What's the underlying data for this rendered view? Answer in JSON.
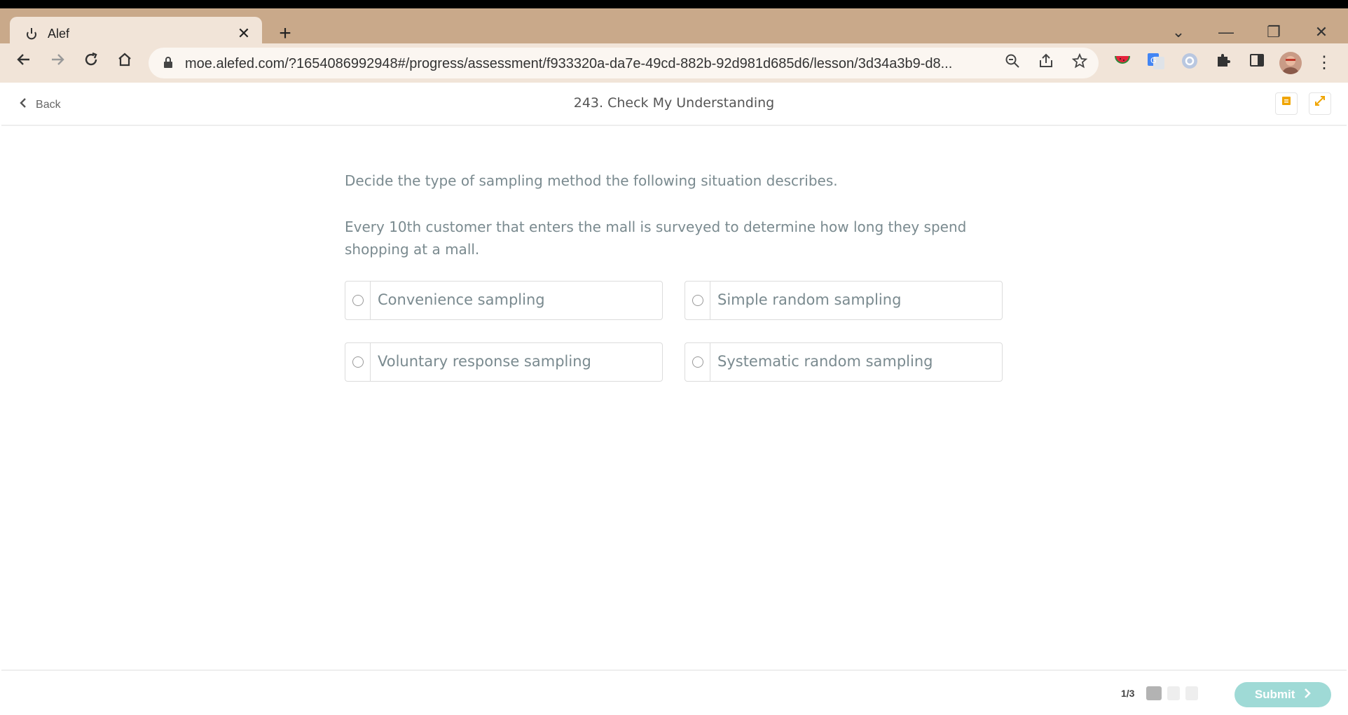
{
  "browser": {
    "tab_title": "Alef",
    "tab_close": "✕",
    "new_tab": "+",
    "url": "moe.alefed.com/?1654086992948#/progress/assessment/f933320a-da7e-49cd-882b-92d981d685d6/lesson/3d34a3b9-d8...",
    "window_controls": [
      "⌄",
      "—",
      "❐",
      "✕"
    ]
  },
  "app_header": {
    "back_label": "Back",
    "title": "243. Check My Understanding"
  },
  "question": {
    "prompt": "Decide the type of sampling method the following situation describes.",
    "situation": "Every 10th customer that enters the mall is surveyed to determine how long they spend shopping at a mall.",
    "options": [
      {
        "label": "Convenience sampling"
      },
      {
        "label": "Simple random sampling"
      },
      {
        "label": "Voluntary response sampling"
      },
      {
        "label": "Systematic random sampling"
      }
    ]
  },
  "footer": {
    "progress": "1/3",
    "current_page": 1,
    "total_pages": 3,
    "submit_label": "Submit"
  },
  "colors": {
    "chrome_top": "#c9a98a",
    "chrome_toolbar": "#f1e4d8",
    "text_muted": "#7a8a8f",
    "submit_bg": "#9fdad6",
    "accent_orange": "#f0a500"
  }
}
